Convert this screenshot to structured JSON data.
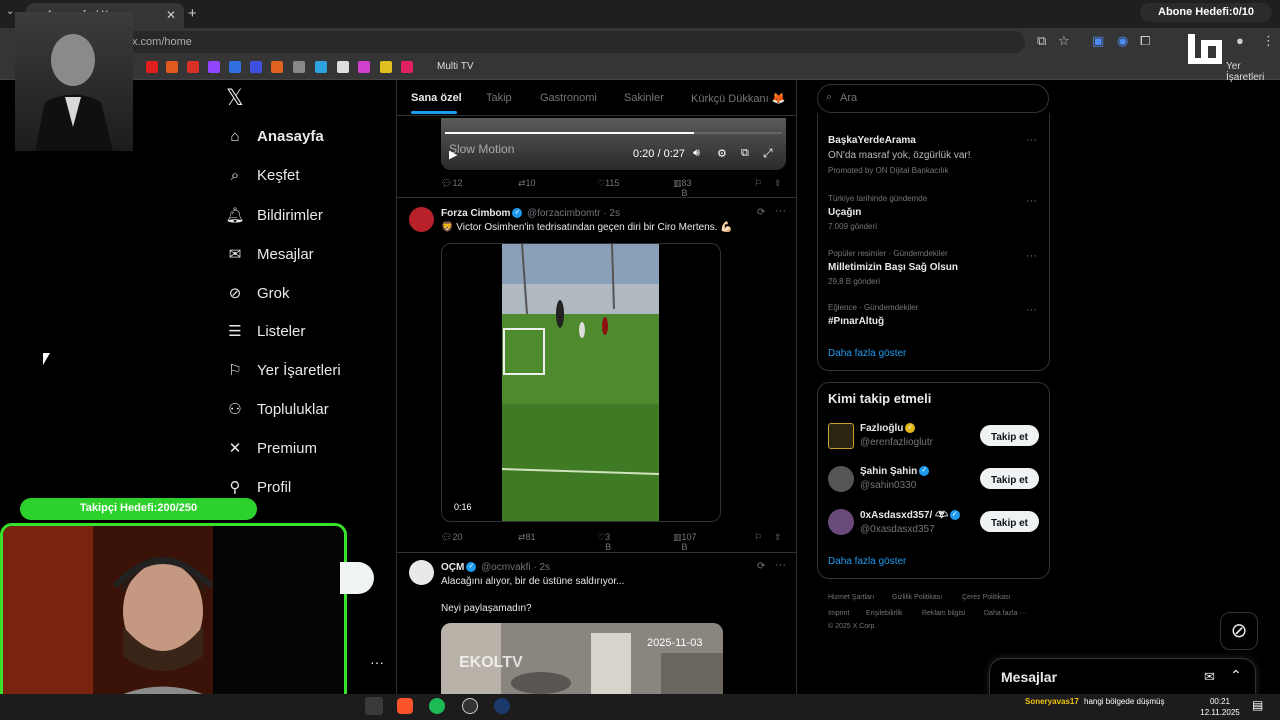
{
  "browser": {
    "tab_title": "Anasayfa / X",
    "url": "x.com/home",
    "bookmark_folder": "Multi TV",
    "bookmarks_right": "Yer İşaretleri"
  },
  "overlay": {
    "subscriber_goal": "Abone Hedefi:0/10",
    "follower_goal": "Takipçi Hedefi:200/250",
    "logo_text": "UGO"
  },
  "sidebar": {
    "items": [
      {
        "label": "Anasayfa",
        "icon": "home-icon"
      },
      {
        "label": "Keşfet",
        "icon": "search-icon"
      },
      {
        "label": "Bildirimler",
        "icon": "bell-icon"
      },
      {
        "label": "Mesajlar",
        "icon": "mail-icon"
      },
      {
        "label": "Grok",
        "icon": "grok-icon"
      },
      {
        "label": "Listeler",
        "icon": "list-icon"
      },
      {
        "label": "Yer İşaretleri",
        "icon": "bookmark-icon"
      },
      {
        "label": "Topluluklar",
        "icon": "communities-icon"
      },
      {
        "label": "Premium",
        "icon": "x-icon"
      },
      {
        "label": "Profil",
        "icon": "user-icon"
      }
    ]
  },
  "feed": {
    "tabs": [
      "Sana özel",
      "Takip",
      "Gastronomi",
      "Sakinler",
      "Kürkçü Dükkanı 🦊"
    ],
    "active_tab": "Sana özel",
    "video1": {
      "time": "0:20 / 0:27",
      "label": "Slow Motion",
      "progress": 0.74,
      "actions": {
        "replies": "12",
        "reposts": "10",
        "likes": "115",
        "views": "83 B"
      }
    },
    "tweet2": {
      "name": "Forza Cimbom",
      "handle": "@forzacimbomtr",
      "time": "· 2s",
      "text": "🦁 Victor Osimhen'in tedrisatından geçen diri bir Ciro Mertens. 💪🏻",
      "duration": "0:16",
      "actions": {
        "replies": "20",
        "reposts": "81",
        "likes": "3 B",
        "views": "107 B"
      }
    },
    "tweet3": {
      "name": "OÇM",
      "handle": "@ocmvakfi",
      "time": "· 2s",
      "text1": "Alacağını alıyor, bir de üstüne saldırıyor...",
      "text2": "Neyi paylaşamadın?",
      "image_date": "2025-11-03",
      "image_watermark": "EKOLTV"
    }
  },
  "right": {
    "search_placeholder": "Ara",
    "trends": [
      {
        "meta": "",
        "title": "BaşkaYerdeArama",
        "sub": "ON'da masraf yok, özgürlük var!",
        "extra": "Promoted by ON Dijital Bankacılık"
      },
      {
        "meta": "Türkiye tarihinde gündemde",
        "title": "Uçağın",
        "sub": "7.009 gönderi"
      },
      {
        "meta": "Popüler resimler · Gündemdekiler",
        "title": "Milletimizin Başı Sağ Olsun",
        "sub": "29,8 B gönderi"
      },
      {
        "meta": "Eğlence · Gündemdekiler",
        "title": "#PınarAltuğ",
        "sub": ""
      }
    ],
    "show_more": "Daha fazla göster",
    "who_to_follow_title": "Kimi takip etmeli",
    "who_to_follow": [
      {
        "name": "Fazlıoğlu",
        "handle": "@erenfazlioglutr",
        "button": "Takip et"
      },
      {
        "name": "Şahin Şahin",
        "handle": "@sahin0330",
        "button": "Takip et"
      },
      {
        "name": "0xAsdasxd357/",
        "handle": "@0xasdasxd357",
        "button": "Takip et"
      }
    ],
    "show_more2": "Daha fazla göster",
    "footer": [
      "Hizmet Şartları",
      "Gizlilik Politikası",
      "Çerez Politikası",
      "Imprint",
      "Erişilebilirlik",
      "Reklam bilgisi",
      "Daha fazla ···",
      "© 2025 X Corp."
    ],
    "messages": "Mesajlar"
  },
  "taskbar": {
    "chat_user": "Soneryavas17",
    "chat_msg": "hangi bölgede düşmüş",
    "time": "00:21",
    "date": "12.11.2025"
  },
  "colors": {
    "accent": "#1d9bf0",
    "follower_bar": "#2cd12c",
    "webcam_border": "#38e22c"
  }
}
